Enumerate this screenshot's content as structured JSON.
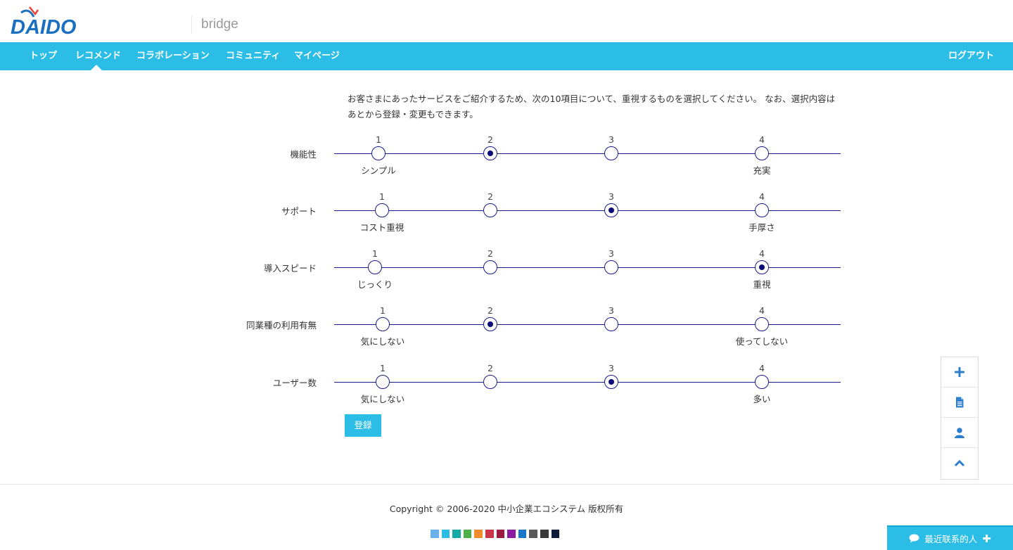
{
  "header": {
    "logo_text": "DAIDO",
    "brand": "bridge"
  },
  "nav": {
    "items": [
      {
        "label": "トップ"
      },
      {
        "label": "レコメンド"
      },
      {
        "label": "コラボレーション"
      },
      {
        "label": "コミュニティ"
      },
      {
        "label": "マイページ"
      }
    ],
    "active_item": "レコメンド",
    "logout": "ログアウト"
  },
  "intro": {
    "text": "お客さまにあったサービスをご紹介するため、次の10項目について、重視するものを選択してください。 なお、選択内容はあとから登録・変更もできます。"
  },
  "scales": [
    {
      "label": "機能性",
      "options": [
        "1",
        "2",
        "3",
        "4"
      ],
      "selected": "2",
      "low_label": "シンプル",
      "high_label": "充実"
    },
    {
      "label": "サポート",
      "options": [
        "1",
        "2",
        "3",
        "4"
      ],
      "selected": "3",
      "low_label": "コスト重視",
      "high_label": "手厚さ"
    },
    {
      "label": "導入スピード",
      "options": [
        "1",
        "2",
        "3",
        "4"
      ],
      "selected": "4",
      "low_label": "じっくり",
      "high_label": "重視"
    },
    {
      "label": "同業種の利用有無",
      "options": [
        "1",
        "2",
        "3",
        "4"
      ],
      "selected": "2",
      "low_label": "気にしない",
      "high_label": "使ってしない"
    },
    {
      "label": "ユーザー数",
      "options": [
        "1",
        "2",
        "3",
        "4"
      ],
      "selected": "3",
      "low_label": "気にしない",
      "high_label": "多い"
    }
  ],
  "form": {
    "register_label": "登録"
  },
  "float_toolbar": {
    "icons": [
      "plus-icon",
      "document-icon",
      "user-icon",
      "chevron-up-icon"
    ]
  },
  "footer": {
    "copyright": "Copyright © 2006-2020 中小企業エコシステム 版权所有",
    "theme_colors": [
      "#6ab0ea",
      "#2bbde6",
      "#13aaa8",
      "#4eae48",
      "#f08c2e",
      "#c9344b",
      "#9c1a3f",
      "#8c1aa0",
      "#1a78c9",
      "#5a5a5a",
      "#3a3a3a",
      "#0e1a3a"
    ]
  },
  "chat": {
    "label": "最近联系的人"
  },
  "colors": {
    "accent": "#2bbde6",
    "radio": "#1a1a8c"
  }
}
